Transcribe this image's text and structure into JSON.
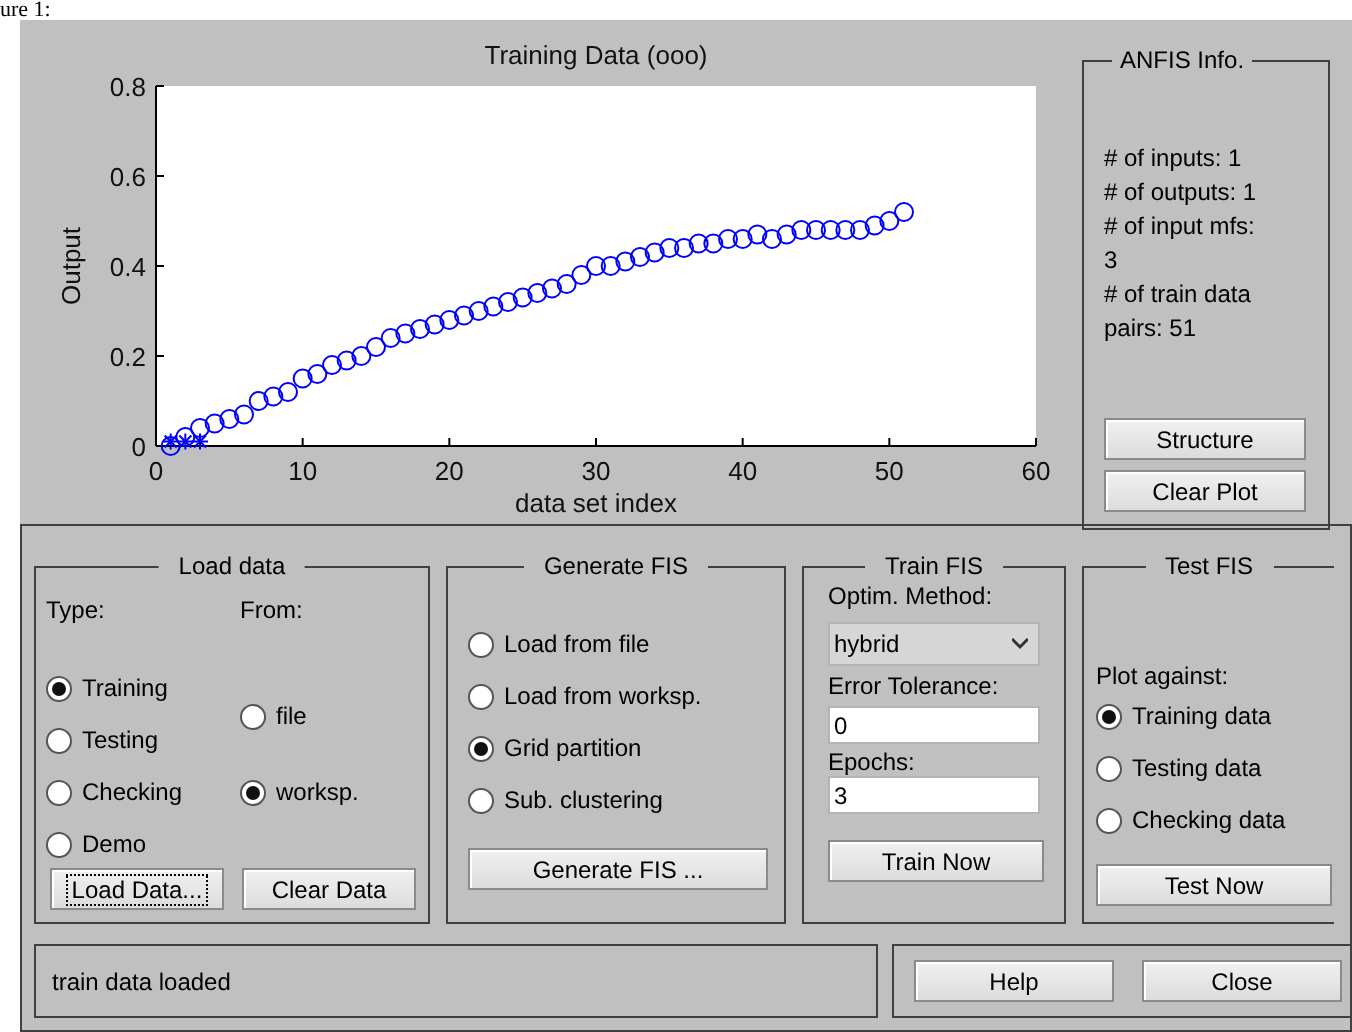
{
  "caption_fragment": "ure 1:",
  "plot": {
    "chart_data": {
      "type": "scatter",
      "title": "Training Data (ooo)",
      "xlabel": "data set index",
      "ylabel": "Output",
      "xlim": [
        0,
        60
      ],
      "ylim": [
        0,
        0.8
      ],
      "xticks": [
        0,
        10,
        20,
        30,
        40,
        50,
        60
      ],
      "yticks": [
        0,
        0.2,
        0.4,
        0.6,
        0.8
      ],
      "x": [
        1,
        2,
        3,
        4,
        5,
        6,
        7,
        8,
        9,
        10,
        11,
        12,
        13,
        14,
        15,
        16,
        17,
        18,
        19,
        20,
        21,
        22,
        23,
        24,
        25,
        26,
        27,
        28,
        29,
        30,
        31,
        32,
        33,
        34,
        35,
        36,
        37,
        38,
        39,
        40,
        41,
        42,
        43,
        44,
        45,
        46,
        47,
        48,
        49,
        50,
        51
      ],
      "series": [
        {
          "color": "#0000ff",
          "values": [
            0.0,
            0.02,
            0.04,
            0.05,
            0.06,
            0.07,
            0.1,
            0.11,
            0.12,
            0.15,
            0.16,
            0.18,
            0.19,
            0.2,
            0.22,
            0.24,
            0.25,
            0.26,
            0.27,
            0.28,
            0.29,
            0.3,
            0.31,
            0.32,
            0.33,
            0.34,
            0.35,
            0.36,
            0.38,
            0.4,
            0.4,
            0.41,
            0.42,
            0.43,
            0.44,
            0.44,
            0.45,
            0.45,
            0.46,
            0.46,
            0.47,
            0.46,
            0.47,
            0.48,
            0.48,
            0.48,
            0.48,
            0.48,
            0.49,
            0.5,
            0.52
          ]
        },
        {
          "color": "#0000ff",
          "values": [
            0.01,
            0.01,
            0.01,
            null,
            null,
            null,
            null,
            null,
            null,
            null,
            null,
            null,
            null,
            null,
            null,
            null,
            null,
            null,
            null,
            null,
            null,
            null,
            null,
            null,
            null,
            null,
            null,
            null,
            null,
            null,
            null,
            null,
            null,
            null,
            null,
            null,
            null,
            null,
            null,
            null,
            null,
            null,
            null,
            null,
            null,
            null,
            null,
            null,
            null,
            null,
            null
          ]
        }
      ]
    }
  },
  "anfis_info": {
    "title": "ANFIS Info.",
    "lines": [
      "# of inputs: 1",
      "# of outputs: 1",
      "# of input mfs:",
      "3",
      "# of train data",
      "pairs: 51"
    ],
    "buttons": [
      "Structure",
      "Clear Plot"
    ]
  },
  "load_data": {
    "title": "Load data",
    "type_label": "Type:",
    "from_label": "From:",
    "type_options": [
      {
        "label": "Training",
        "selected": true
      },
      {
        "label": "Testing",
        "selected": false
      },
      {
        "label": "Checking",
        "selected": false
      },
      {
        "label": "Demo",
        "selected": false
      }
    ],
    "from_options": [
      {
        "label": "file",
        "selected": false
      },
      {
        "label": "worksp.",
        "selected": true
      }
    ],
    "buttons": [
      {
        "label": "Load Data...",
        "focused": true
      },
      {
        "label": "Clear Data",
        "focused": false
      }
    ]
  },
  "generate_fis": {
    "title": "Generate FIS",
    "options": [
      {
        "label": "Load from file",
        "selected": false
      },
      {
        "label": "Load from worksp.",
        "selected": false
      },
      {
        "label": "Grid partition",
        "selected": true
      },
      {
        "label": "Sub. clustering",
        "selected": false
      }
    ],
    "button": "Generate FIS ..."
  },
  "train_fis": {
    "title": "Train FIS",
    "method_label": "Optim. Method:",
    "method": "hybrid",
    "tolerance_label": "Error Tolerance:",
    "tolerance": "0",
    "epochs_label": "Epochs:",
    "epochs": "3",
    "button": "Train Now"
  },
  "test_fis": {
    "title": "Test FIS",
    "plot_against_label": "Plot against:",
    "options": [
      {
        "label": "Training data",
        "selected": true
      },
      {
        "label": "Testing data",
        "selected": false
      },
      {
        "label": "Checking data",
        "selected": false
      }
    ],
    "button": "Test Now"
  },
  "status": "train data loaded",
  "buttons": [
    "Help",
    "Close"
  ]
}
